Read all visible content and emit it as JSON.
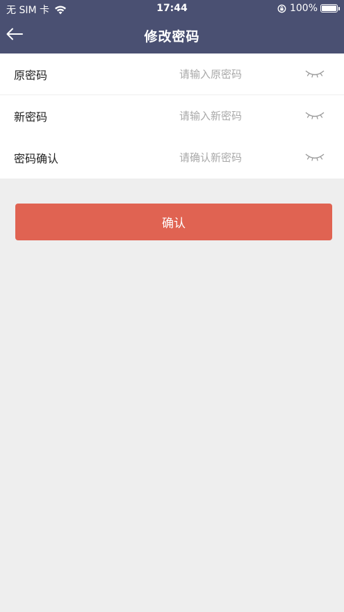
{
  "status_bar": {
    "carrier": "无 SIM 卡",
    "time": "17:44",
    "battery": "100%"
  },
  "nav": {
    "title": "修改密码",
    "back_icon": "arrow-left-icon"
  },
  "form": {
    "rows": [
      {
        "label": "原密码",
        "placeholder": "请输入原密码",
        "value": ""
      },
      {
        "label": "新密码",
        "placeholder": "请输入新密码",
        "value": ""
      },
      {
        "label": "密码确认",
        "placeholder": "请确认新密码",
        "value": ""
      }
    ],
    "toggle_icon": "eye-closed-icon"
  },
  "confirm": {
    "label": "确认"
  },
  "colors": {
    "header_bg": "#4a5072",
    "accent": "#e06352",
    "page_bg": "#eeeeee"
  }
}
